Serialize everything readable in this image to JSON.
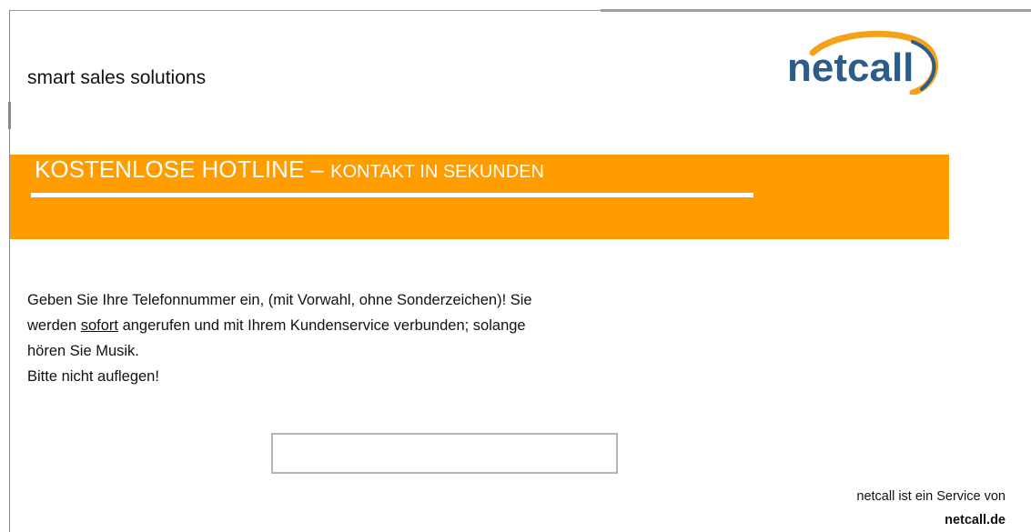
{
  "header": {
    "tagline": "smart sales solutions",
    "logo_text": "netcall"
  },
  "banner": {
    "title": "KOSTENLOSE HOTLINE",
    "separator": "–",
    "subtitle": "KONTAKT IN SEKUNDEN"
  },
  "instructions": {
    "line1": "Geben Sie Ihre Telefonnummer ein, (mit Vorwahl, ohne Sonderzeichen)! Sie",
    "line2_before": "werden ",
    "line2_emph": "sofort",
    "line2_after": " angerufen und mit Ihrem Kundenservice verbunden; solange",
    "line3": "hören Sie Musik.",
    "line4": "Bitte nicht auflegen!"
  },
  "phone_input": {
    "value": "",
    "placeholder": ""
  },
  "footer": {
    "service_text": "netcall ist ein Service von",
    "service_link": "netcall.de"
  },
  "colors": {
    "accent": "#ff9c00",
    "logo_blue": "#2b5c8a",
    "border": "#9e9e9e"
  }
}
